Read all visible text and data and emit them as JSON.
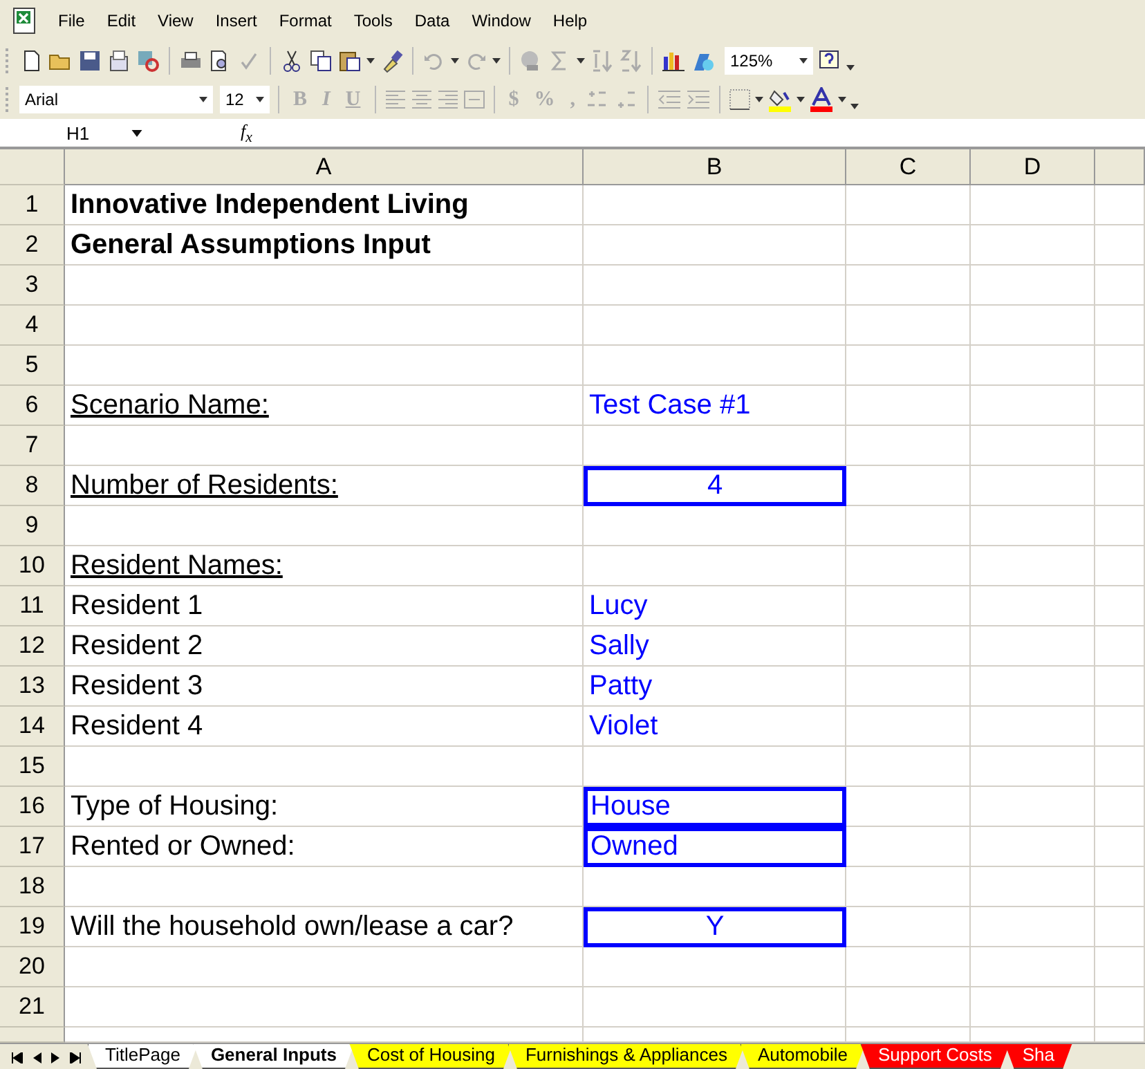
{
  "menu": [
    "File",
    "Edit",
    "View",
    "Insert",
    "Format",
    "Tools",
    "Data",
    "Window",
    "Help"
  ],
  "standard_toolbar": {
    "zoom": "125%"
  },
  "formatting_toolbar": {
    "font": "Arial",
    "size": "12",
    "buttons": [
      {
        "text": "B",
        "kind": "bold",
        "disabled": true
      },
      {
        "text": "I",
        "kind": "italic",
        "disabled": true
      },
      {
        "text": "U",
        "kind": "underline",
        "disabled": true
      }
    ],
    "number_buttons": [
      {
        "text": "$",
        "disabled": true
      },
      {
        "text": "%",
        "disabled": true
      },
      {
        "text": ",",
        "disabled": true
      }
    ]
  },
  "formula_bar": {
    "name_box": "H1",
    "fx": "f$_{x}$"
  },
  "columns": [
    "A",
    "B",
    "C",
    "D"
  ],
  "rows": [
    {
      "num": "1",
      "a": "Innovative Independent Living",
      "bold": true,
      "underline": false
    },
    {
      "num": "2",
      "a": "General Assumptions Input",
      "bold": true,
      "underline": false
    },
    {
      "num": "3"
    },
    {
      "num": "4"
    },
    {
      "num": "5"
    },
    {
      "num": "6",
      "a": "Scenario Name:",
      "bold": false,
      "underline": true,
      "b": {
        "text": "Test Case #1",
        "boxed": false,
        "centered": false
      }
    },
    {
      "num": "7"
    },
    {
      "num": "8",
      "a": "Number of Residents:",
      "bold": false,
      "underline": true,
      "b": {
        "text": "4",
        "boxed": true,
        "centered": true
      }
    },
    {
      "num": "9"
    },
    {
      "num": "10",
      "a": "Resident Names:",
      "bold": false,
      "underline": true
    },
    {
      "num": "11",
      "a": "Resident 1",
      "bold": false,
      "underline": false,
      "b": {
        "text": "Lucy",
        "boxed": false,
        "centered": false
      }
    },
    {
      "num": "12",
      "a": "Resident 2",
      "bold": false,
      "underline": false,
      "b": {
        "text": "Sally",
        "boxed": false,
        "centered": false
      }
    },
    {
      "num": "13",
      "a": "Resident 3",
      "bold": false,
      "underline": false,
      "b": {
        "text": "Patty",
        "boxed": false,
        "centered": false
      }
    },
    {
      "num": "14",
      "a": "Resident 4",
      "bold": false,
      "underline": false,
      "b": {
        "text": "Violet",
        "boxed": false,
        "centered": false
      }
    },
    {
      "num": "15"
    },
    {
      "num": "16",
      "a": "Type of Housing:",
      "bold": false,
      "underline": false,
      "b": {
        "text": "House",
        "boxed": true,
        "centered": false
      }
    },
    {
      "num": "17",
      "a": "Rented or Owned:",
      "bold": false,
      "underline": false,
      "b": {
        "text": "Owned",
        "boxed": true,
        "centered": false
      }
    },
    {
      "num": "18"
    },
    {
      "num": "19",
      "a": "Will the household own/lease a car?",
      "bold": false,
      "underline": false,
      "b": {
        "text": "Y",
        "boxed": true,
        "centered": true
      }
    },
    {
      "num": "20"
    },
    {
      "num": "21"
    }
  ],
  "sheet_tabs": [
    {
      "label": "TitlePage",
      "selected": false,
      "color": "#ffffff"
    },
    {
      "label": "General Inputs",
      "selected": true,
      "color": "#ffffff"
    },
    {
      "label": "Cost of Housing",
      "selected": false,
      "color": "#ffff00"
    },
    {
      "label": "Furnishings & Appliances",
      "selected": false,
      "color": "#ffff00"
    },
    {
      "label": "Automobile",
      "selected": false,
      "color": "#ffff00"
    },
    {
      "label": "Support Costs",
      "selected": false,
      "color": "#ff0000"
    },
    {
      "label": "Sha",
      "selected": false,
      "color": "#ff0000"
    }
  ]
}
